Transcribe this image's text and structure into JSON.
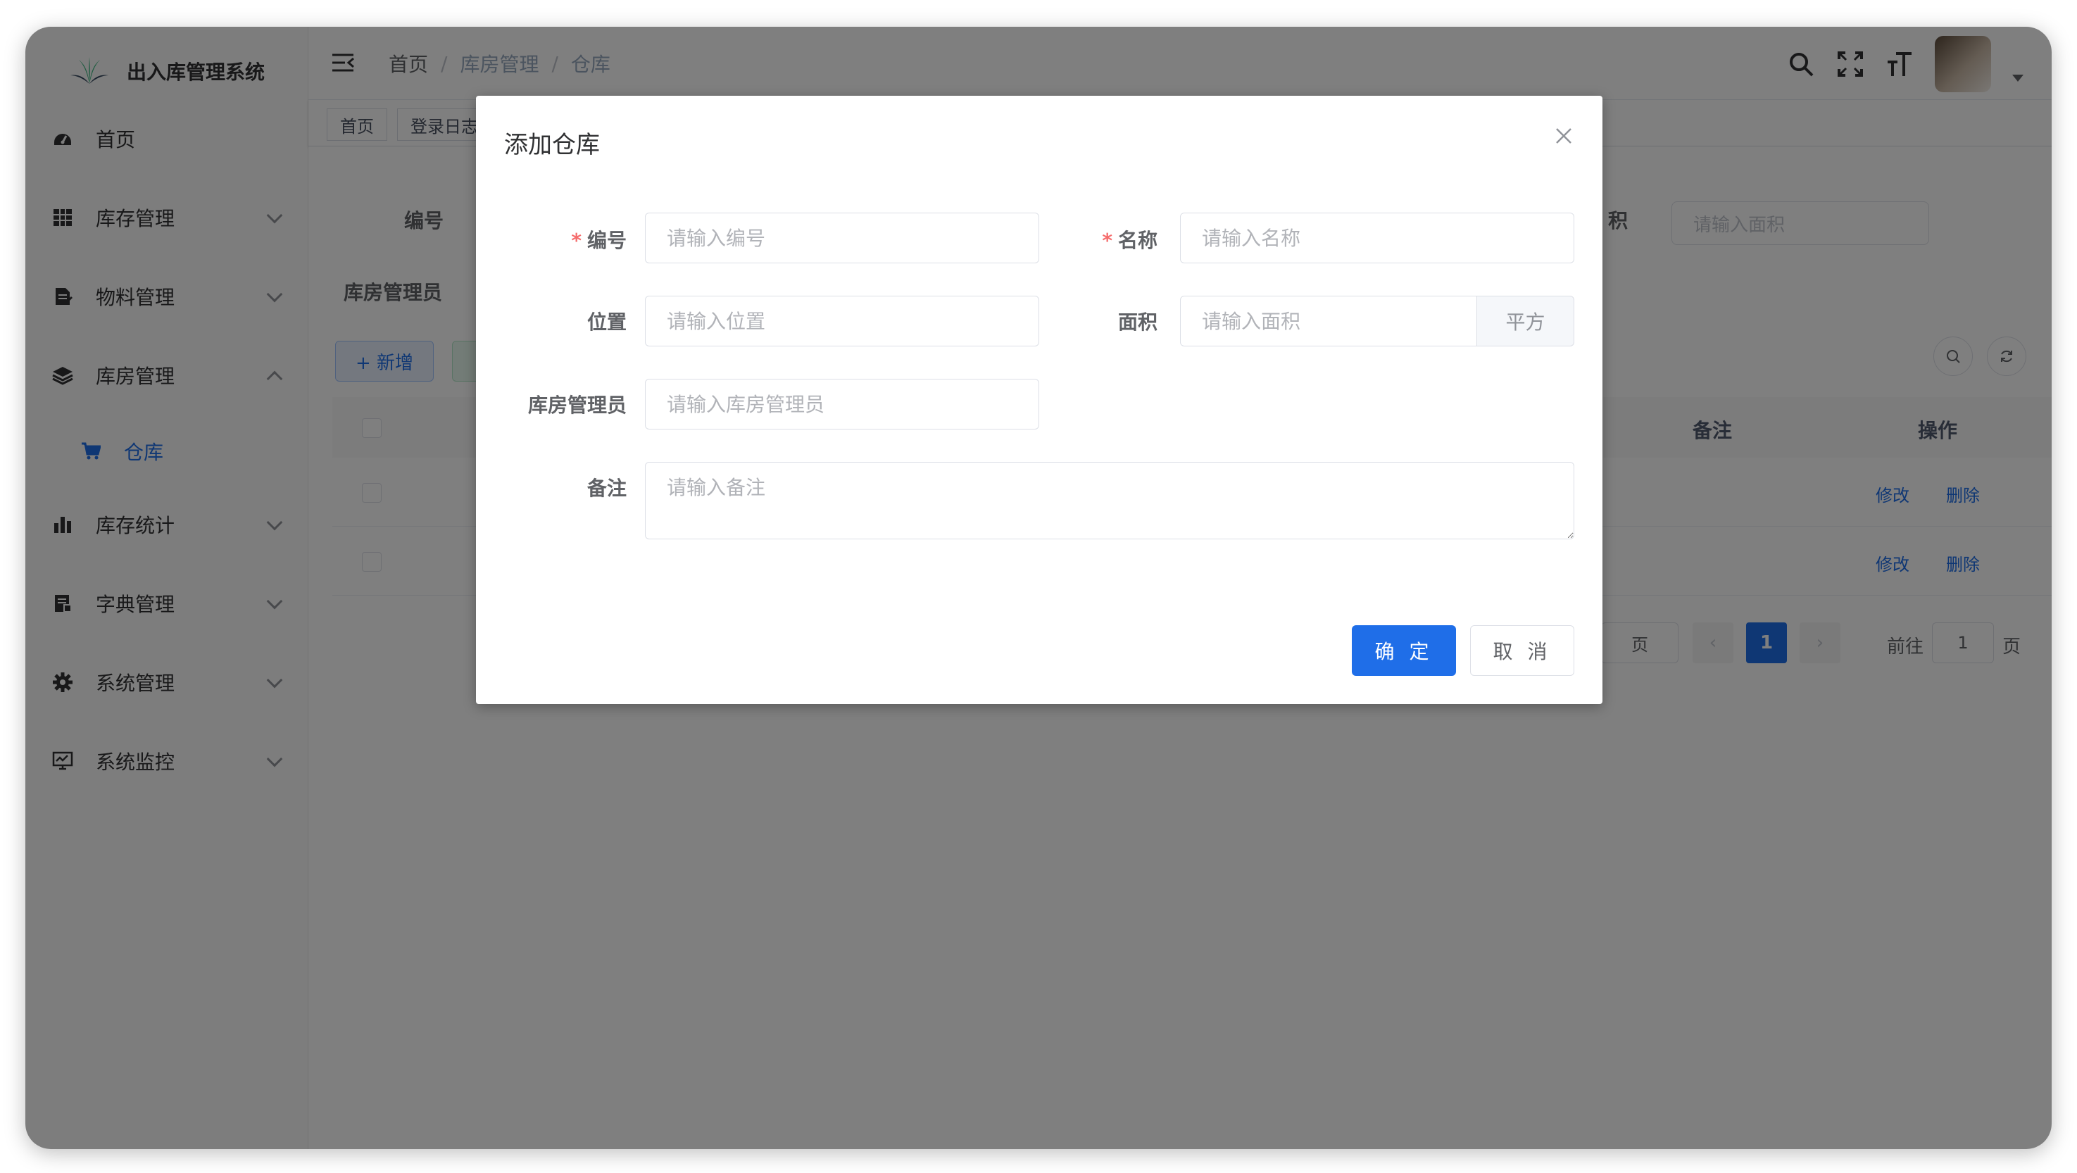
{
  "app": {
    "title": "出入库管理系统"
  },
  "sidebar": {
    "items": [
      {
        "label": "首页",
        "icon": "dashboard-icon"
      },
      {
        "label": "库存管理",
        "icon": "grid-icon"
      },
      {
        "label": "物料管理",
        "icon": "document-icon"
      },
      {
        "label": "库房管理",
        "icon": "layers-icon"
      },
      {
        "label": "仓库",
        "icon": "cart-icon"
      },
      {
        "label": "库存统计",
        "icon": "bar-chart-icon"
      },
      {
        "label": "字典管理",
        "icon": "dictionary-icon"
      },
      {
        "label": "系统管理",
        "icon": "gear-icon"
      },
      {
        "label": "系统监控",
        "icon": "monitor-icon"
      }
    ]
  },
  "header": {
    "breadcrumb": [
      "首页",
      "库房管理",
      "仓库"
    ],
    "breadcrumb_sep": "/"
  },
  "tags": [
    "首页",
    "登录日志"
  ],
  "search_form": {
    "code_label": "编号",
    "area_label_partial": "积",
    "area_placeholder": "请输入面积",
    "manager_label": "库房管理员"
  },
  "toolbar": {
    "add_label": "+ 新增"
  },
  "table": {
    "columns": [
      "备注",
      "操作"
    ],
    "rows": [
      {
        "edit": "修改",
        "delete": "删除"
      },
      {
        "edit": "修改",
        "delete": "删除"
      }
    ]
  },
  "pagination": {
    "size_suffix": "页",
    "current_page": "1",
    "goto_label": "前往",
    "goto_value": "1",
    "goto_suffix": "页"
  },
  "dialog": {
    "title": "添加仓库",
    "fields": {
      "code": {
        "label": "编号",
        "placeholder": "请输入编号",
        "required": true
      },
      "name": {
        "label": "名称",
        "placeholder": "请输入名称",
        "required": true
      },
      "location": {
        "label": "位置",
        "placeholder": "请输入位置"
      },
      "area": {
        "label": "面积",
        "placeholder": "请输入面积",
        "unit": "平方"
      },
      "manager": {
        "label": "库房管理员",
        "placeholder": "请输入库房管理员"
      },
      "remark": {
        "label": "备注",
        "placeholder": "请输入备注"
      }
    },
    "required_mark": "*",
    "confirm_label": "确 定",
    "cancel_label": "取 消"
  },
  "colors": {
    "primary": "#1f6ee8",
    "required": "#f56c6c",
    "overlay": "rgba(0,0,0,0.5)"
  }
}
